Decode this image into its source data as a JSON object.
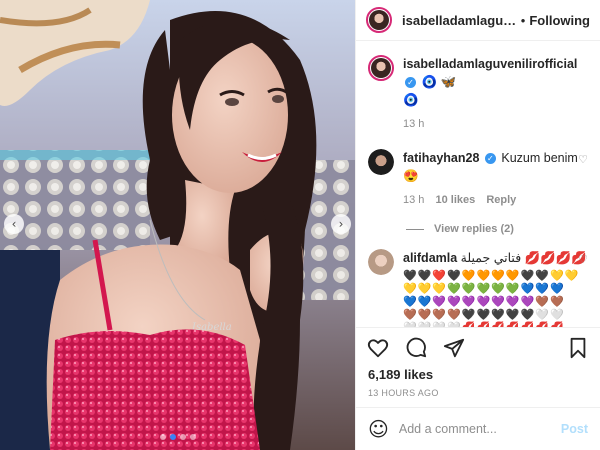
{
  "header": {
    "username": "isabelladamlaguvenilir",
    "follow_label": "Following",
    "separator": "•"
  },
  "caption": {
    "username": "isabelladamlaguvenilirofficial",
    "emojis": "🧿 🦋",
    "emoji2": "🧿",
    "time": "13 h"
  },
  "comments": [
    {
      "username": "fatihayhan28",
      "text": "Kuzum benim 😍",
      "time": "13 h",
      "likes": "10 likes",
      "reply": "Reply",
      "view_replies": "View replies (2)"
    },
    {
      "username": "alifdamla",
      "text": "فتاتي جميلة 💋💋💋💋",
      "emoji_rows": [
        "🖤🖤❤️🖤🧡🧡🧡🧡🖤🖤💛💛",
        "💛💛💛💚💚💚💚💚💙💙💙",
        "💙💙💜💜💜💜💜💜💜🤎🤎",
        "🤎🤎🤎🤎🖤🖤🖤🖤🖤🤍🤍",
        "🤍🤍🤍🤍💋💋💋💋💋💋💋",
        "💋💥💥💥💥💥🥏🥏🥏🥏🥏",
        "💣💣💣💣💣💣💣"
      ]
    }
  ],
  "likes": "6,189 likes",
  "posted": "13 HOURS AGO",
  "composer": {
    "placeholder": "Add a comment...",
    "post_label": "Post"
  },
  "carousel": {
    "slides": 4,
    "active": 1
  },
  "colors": {
    "accent": "#3897f0",
    "follow_ring": "#d62976",
    "dress": "#d3174e"
  },
  "icons": [
    "verified-icon",
    "heart-icon",
    "comment-icon",
    "share-icon",
    "bookmark-icon",
    "smile-icon",
    "chevron-left-icon",
    "chevron-right-icon"
  ]
}
